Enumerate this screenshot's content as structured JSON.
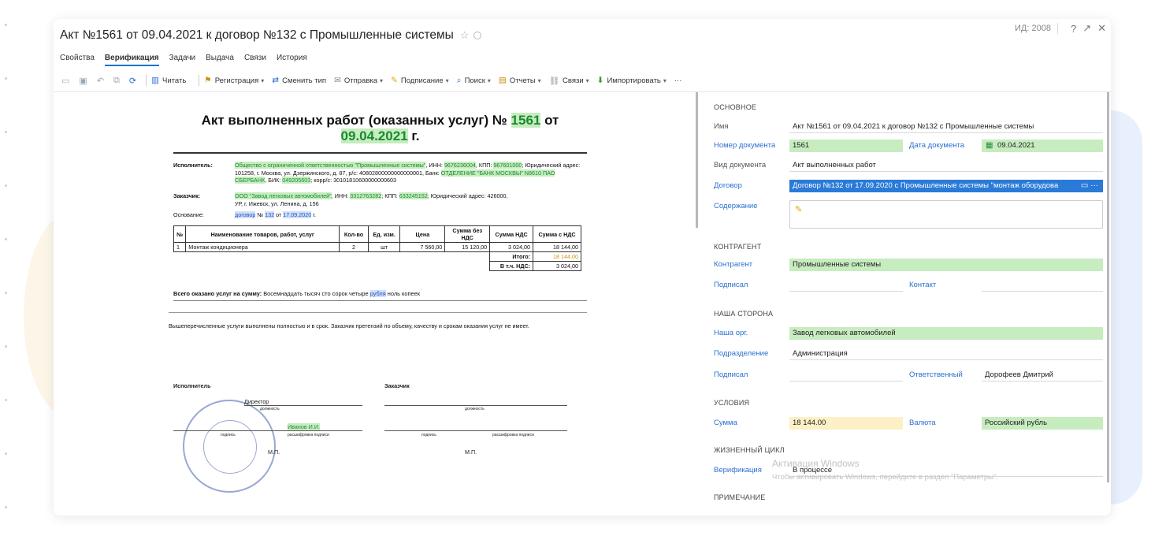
{
  "window": {
    "title": "Акт №1561 от 09.04.2021 к договор №132 с Промышленные системы",
    "id_label": "ИД: 2008"
  },
  "tabs": [
    "Свойства",
    "Верификация",
    "Задачи",
    "Выдача",
    "Связи",
    "История"
  ],
  "active_tab": "Верификация",
  "toolbar": {
    "read": "Читать",
    "registration": "Регистрация",
    "change_type": "Сменить тип",
    "send": "Отправка",
    "sign": "Подписание",
    "search": "Поиск",
    "reports": "Отчеты",
    "links": "Связи",
    "import": "Импортировать",
    "more": "···"
  },
  "document": {
    "title_prefix": "Акт выполненных работ (оказанных услуг) №",
    "number": "1561",
    "date_prefix": "от",
    "date": "09.04.2021",
    "date_suffix": "г.",
    "executor_label": "Исполнитель:",
    "executor_name": "Общество с ограниченной ответственностью \"Промышленные системы\"",
    "executor_inn_label": ", ИНН:",
    "executor_inn": "9676236004",
    "executor_kpp_label": ", КПП:",
    "executor_kpp": "967601000",
    "executor_rest": "; Юридический адрес: 101258, г. Москва, ул. Дзержинского, д. 87, р/с: 40802800000000000001,",
    "executor_bank_label": "Банк:",
    "executor_bank": "ОТДЕЛЕНИЕ \"БАНК МОСКВЫ\" N8610 ПАО СБЕРБАНК",
    "executor_bik_label": ", БИК:",
    "executor_bik": "049205603",
    "executor_korr": "; корр/с:",
    "executor_korr_num": "30101810600000000603",
    "customer_label": "Заказчик:",
    "customer_name": "ООО \"Завод легковых автомобилей\"",
    "customer_inn_label": ", ИНН:",
    "customer_inn": "3312763282",
    "customer_kpp_label": "; КПП:",
    "customer_kpp": "633245152",
    "customer_rest": "; Юридический адрес: 426000,",
    "customer_addr2": "УР, г. Ижевск, ул. Ленина, д. 156",
    "basis_label": "Основание:",
    "basis_doc": "договор",
    "basis_no": "№",
    "basis_num": "132",
    "basis_from": "от",
    "basis_date": "17.09.2020",
    "basis_end": "г.",
    "table_headers": [
      "№",
      "Наименование товаров, работ, услуг",
      "Кол-во",
      "Ед. изм.",
      "Цена",
      "Сумма без НДС",
      "Сумма НДС",
      "Сумма с НДС"
    ],
    "table_rows": [
      [
        "1",
        "Монтаж кондиционера",
        "2",
        "шт",
        "7 560,00",
        "15 120,00",
        "3 024,00",
        "18 144,00"
      ]
    ],
    "total_label": "Итого:",
    "total_value": "18 144,00",
    "vat_label": "В т.ч. НДС:",
    "vat_value": "3 024,00",
    "sum_words_label": "Всего оказано услуг на сумму:",
    "sum_words_1": "Восемнадцать тысяч сто сорок четыре",
    "sum_words_rub": "рубля",
    "sum_words_2": "ноль копеек",
    "note": "Вышеперечисленные услуги выполнены полностью и в срок. Заказчик претензий по объему, качеству и срокам оказания услуг не имеет.",
    "sign_executor": "Исполнитель",
    "sign_customer": "Заказчик",
    "sign_position": "Директор",
    "sign_position_caption": "должность",
    "sign_name": "Иванов И.И.",
    "sign_signature_caption": "подпись",
    "sign_decode_caption": "расшифровка подписи",
    "sign_mp": "М.П."
  },
  "properties": {
    "section_main": "ОСНОВНОЕ",
    "name_label": "Имя",
    "name_value": "Акт №1561 от 09.04.2021 к договор №132 с Промышленные системы",
    "docnum_label": "Номер документа",
    "docnum_value": "1561",
    "docdate_label": "Дата документа",
    "docdate_value": "09.04.2021",
    "doctype_label": "Вид документа",
    "doctype_value": "Акт выполненных работ",
    "contract_label": "Договор",
    "contract_value": "Договор №132 от 17.09.2020 с Промышленные системы \"монтаж оборудова",
    "contents_label": "Содержание",
    "section_counterparty": "КОНТРАГЕНТ",
    "counterparty_label": "Контрагент",
    "counterparty_value": "Промышленные системы",
    "signed_label": "Подписал",
    "contact_label": "Контакт",
    "section_our": "НАША СТОРОНА",
    "our_org_label": "Наша орг.",
    "our_org_value": "Завод легковых автомобилей",
    "dept_label": "Подразделение",
    "dept_value": "Администрация",
    "our_signed_label": "Подписал",
    "responsible_label": "Ответственный",
    "responsible_value": "Дорофеев Дмитрий",
    "section_terms": "УСЛОВИЯ",
    "sum_label": "Сумма",
    "sum_value": "18 144.00",
    "currency_label": "Валюта",
    "currency_value": "Российский рубль",
    "section_life": "ЖИЗНЕННЫЙ ЦИКЛ",
    "verification_label": "Верификация",
    "verification_value": "В процессе",
    "section_note": "ПРИМЕЧАНИЕ"
  },
  "watermark": {
    "line1": "Активация Windows",
    "line2": "Чтобы активировать Windows, перейдите в раздел \"Параметры\"."
  }
}
